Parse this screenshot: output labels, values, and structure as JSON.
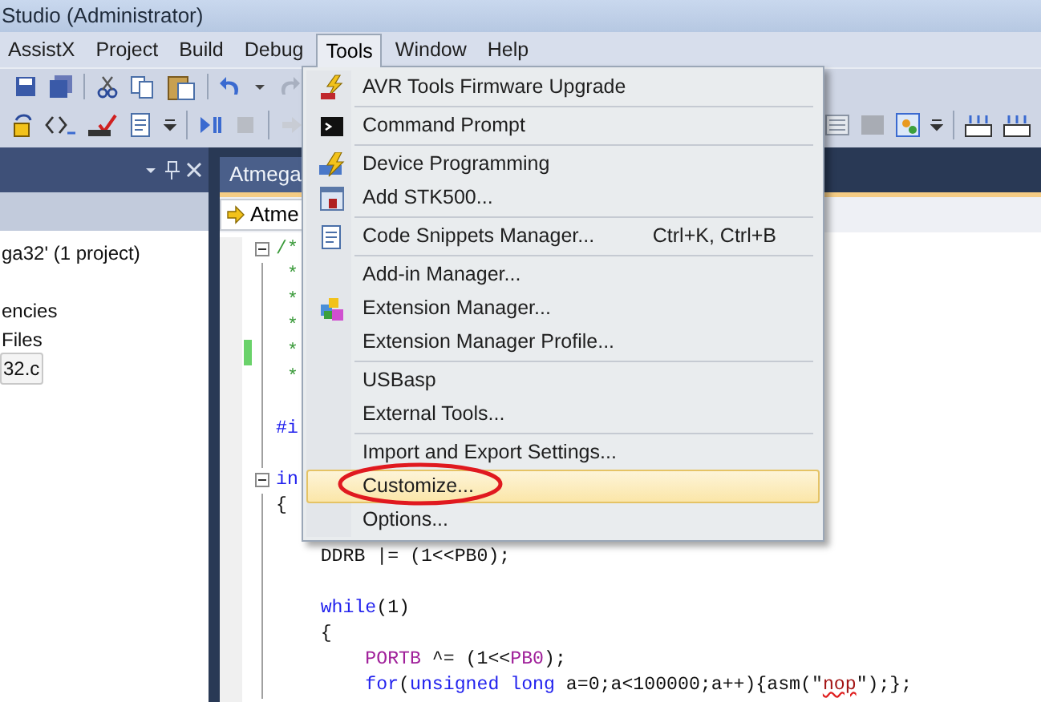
{
  "window": {
    "title": "Studio (Administrator)"
  },
  "menu_bar": [
    {
      "label": "AssistX",
      "selected": false
    },
    {
      "label": "Project",
      "selected": false
    },
    {
      "label": "Build",
      "selected": false
    },
    {
      "label": "Debug",
      "selected": false
    },
    {
      "label": "Tools",
      "selected": true
    },
    {
      "label": "Window",
      "selected": false
    },
    {
      "label": "Help",
      "selected": false
    }
  ],
  "tools_menu": {
    "groups": [
      [
        {
          "label": "AVR Tools Firmware Upgrade",
          "selected": false,
          "circled": false
        }
      ],
      [
        {
          "label": "Command Prompt",
          "selected": false,
          "circled": false
        }
      ],
      [
        {
          "label": "Device Programming",
          "selected": false,
          "circled": false
        },
        {
          "label": "Add STK500...",
          "selected": false,
          "circled": false
        }
      ],
      [
        {
          "label": "Code Snippets Manager...",
          "shortcut": "Ctrl+K, Ctrl+B",
          "selected": false,
          "circled": false
        }
      ],
      [
        {
          "label": "Add-in Manager...",
          "selected": false,
          "circled": false
        },
        {
          "label": "Extension Manager...",
          "selected": false,
          "circled": false
        },
        {
          "label": "Extension Manager Profile...",
          "selected": false,
          "circled": false
        }
      ],
      [
        {
          "label": "USBasp",
          "selected": false,
          "circled": false
        },
        {
          "label": "External Tools...",
          "selected": false,
          "circled": false
        }
      ],
      [
        {
          "label": "Import and Export Settings...",
          "selected": false,
          "circled": false
        },
        {
          "label": "Customize...",
          "selected": true,
          "circled": true
        },
        {
          "label": "Options...",
          "selected": false,
          "circled": false
        }
      ]
    ]
  },
  "solution_explorer": {
    "items": [
      {
        "label": "ga32' (1 project)",
        "selected": false
      },
      {
        "label": "encies",
        "selected": false
      },
      {
        "label": "Files",
        "selected": false
      },
      {
        "label": "32.c",
        "selected": true
      }
    ]
  },
  "editor": {
    "tab": "Atmega",
    "nav_tab": "Atme",
    "lines": [
      {
        "kind": "code",
        "fold": true,
        "changed": false,
        "tokens": [
          {
            "text": "/*",
            "kind": "comment"
          }
        ]
      },
      {
        "kind": "code",
        "fold": false,
        "changed": false,
        "tokens": [
          {
            "text": " *",
            "kind": "comment"
          }
        ]
      },
      {
        "kind": "code",
        "fold": false,
        "changed": false,
        "tokens": [
          {
            "text": " *",
            "kind": "comment"
          }
        ]
      },
      {
        "kind": "code",
        "fold": false,
        "changed": false,
        "tokens": [
          {
            "text": " *",
            "kind": "comment"
          }
        ]
      },
      {
        "kind": "code",
        "fold": false,
        "changed": true,
        "tokens": [
          {
            "text": " *",
            "kind": "comment"
          }
        ]
      },
      {
        "kind": "code",
        "fold": false,
        "changed": false,
        "tokens": [
          {
            "text": " *",
            "kind": "comment"
          }
        ]
      },
      {
        "kind": "blank"
      },
      {
        "kind": "code",
        "fold": false,
        "changed": false,
        "tokens": [
          {
            "text": "#i",
            "kind": "keyword"
          }
        ]
      },
      {
        "kind": "blank"
      },
      {
        "kind": "code",
        "fold": true,
        "changed": false,
        "tokens": [
          {
            "text": "in",
            "kind": "keyword"
          }
        ]
      },
      {
        "kind": "code",
        "fold": false,
        "changed": false,
        "tokens": [
          {
            "text": "{",
            "kind": "plain"
          }
        ]
      },
      {
        "kind": "blank"
      },
      {
        "kind": "code",
        "fold": false,
        "changed": false,
        "tokens": [
          {
            "text": "    DDRB |= (1<<PB0);",
            "kind": "plain"
          }
        ]
      },
      {
        "kind": "blank"
      },
      {
        "kind": "code",
        "fold": false,
        "changed": false,
        "tokens": [
          {
            "text": "    while",
            "kind": "keyword"
          },
          {
            "text": "(1)",
            "kind": "plain"
          }
        ]
      },
      {
        "kind": "code",
        "fold": false,
        "changed": false,
        "tokens": [
          {
            "text": "    {",
            "kind": "plain"
          }
        ]
      },
      {
        "kind": "code",
        "fold": false,
        "changed": false,
        "tokens": [
          {
            "text": "        PORTB",
            "kind": "macro"
          },
          {
            "text": " ^= (1<<",
            "kind": "plain"
          },
          {
            "text": "PB0",
            "kind": "macro"
          },
          {
            "text": ");",
            "kind": "plain"
          }
        ]
      },
      {
        "kind": "code",
        "fold": false,
        "changed": false,
        "tokens": [
          {
            "text": "        for",
            "kind": "keyword"
          },
          {
            "text": "(",
            "kind": "plain"
          },
          {
            "text": "unsigned long",
            "kind": "keyword"
          },
          {
            "text": " a=0;a<100000;a++){asm(\"",
            "kind": "plain"
          },
          {
            "text": "nop",
            "kind": "error"
          },
          {
            "text": "\");};",
            "kind": "plain"
          }
        ]
      }
    ]
  }
}
